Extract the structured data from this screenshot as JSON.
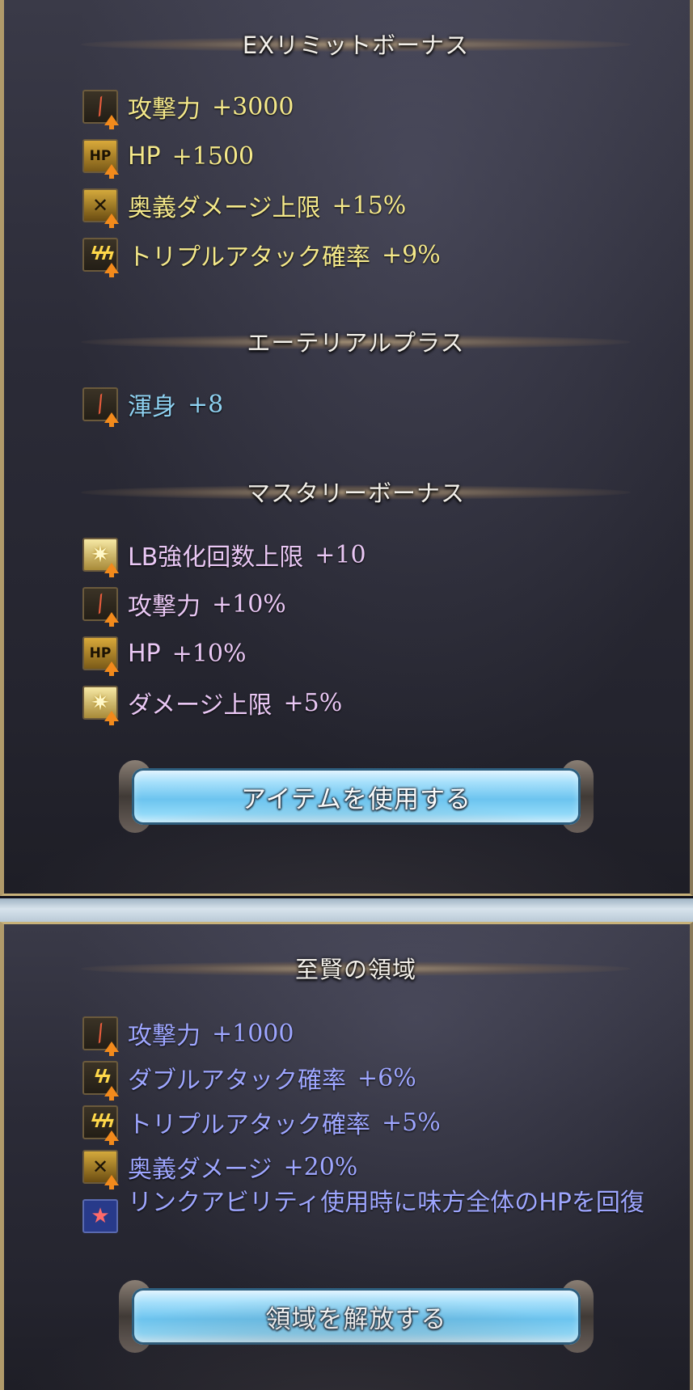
{
  "ex_limit_bonus": {
    "title": "EXリミットボーナス",
    "items": [
      {
        "icon": "attack-icon",
        "label": "攻撃力",
        "value": "+3000"
      },
      {
        "icon": "hp-icon",
        "label": "HP",
        "value": "+1500"
      },
      {
        "icon": "ougi-icon",
        "label": "奥義ダメージ上限",
        "value": "+15%"
      },
      {
        "icon": "triple-attack-icon",
        "label": "トリプルアタック確率",
        "value": "+9%"
      }
    ]
  },
  "ethereal_plus": {
    "title": "エーテリアルプラス",
    "items": [
      {
        "icon": "attack-icon",
        "label": "渾身",
        "value": "+8"
      }
    ]
  },
  "mastery_bonus": {
    "title": "マスタリーボーナス",
    "items": [
      {
        "icon": "limit-burst-icon",
        "label": "LB強化回数上限",
        "value": "+10"
      },
      {
        "icon": "attack-icon",
        "label": "攻撃力",
        "value": "+10%"
      },
      {
        "icon": "hp-icon",
        "label": "HP",
        "value": "+10%"
      },
      {
        "icon": "limit-burst-icon",
        "label": "ダメージ上限",
        "value": "+5%"
      }
    ]
  },
  "use_item_button": {
    "label": "アイテムを使用する"
  },
  "sage_domain": {
    "title": "至賢の領域",
    "items": [
      {
        "icon": "attack-icon",
        "label": "攻撃力",
        "value": "+1000"
      },
      {
        "icon": "double-attack-icon",
        "label": "ダブルアタック確率",
        "value": "+6%"
      },
      {
        "icon": "triple-attack-icon",
        "label": "トリプルアタック確率",
        "value": "+5%"
      },
      {
        "icon": "ougi-icon",
        "label": "奥義ダメージ",
        "value": "+20%"
      },
      {
        "icon": "star-icon",
        "label": "リンクアビリティ使用時に味方全体のHPを回復"
      }
    ]
  },
  "release_domain_button": {
    "label": "領域を解放する"
  },
  "colors": {
    "gold_text": "#f4e88a",
    "cyan_text": "#8fd2f2",
    "lavender_text": "#e9c7f4",
    "blue_text": "#9ea6ff",
    "frame_gold": "#c8b27a"
  }
}
